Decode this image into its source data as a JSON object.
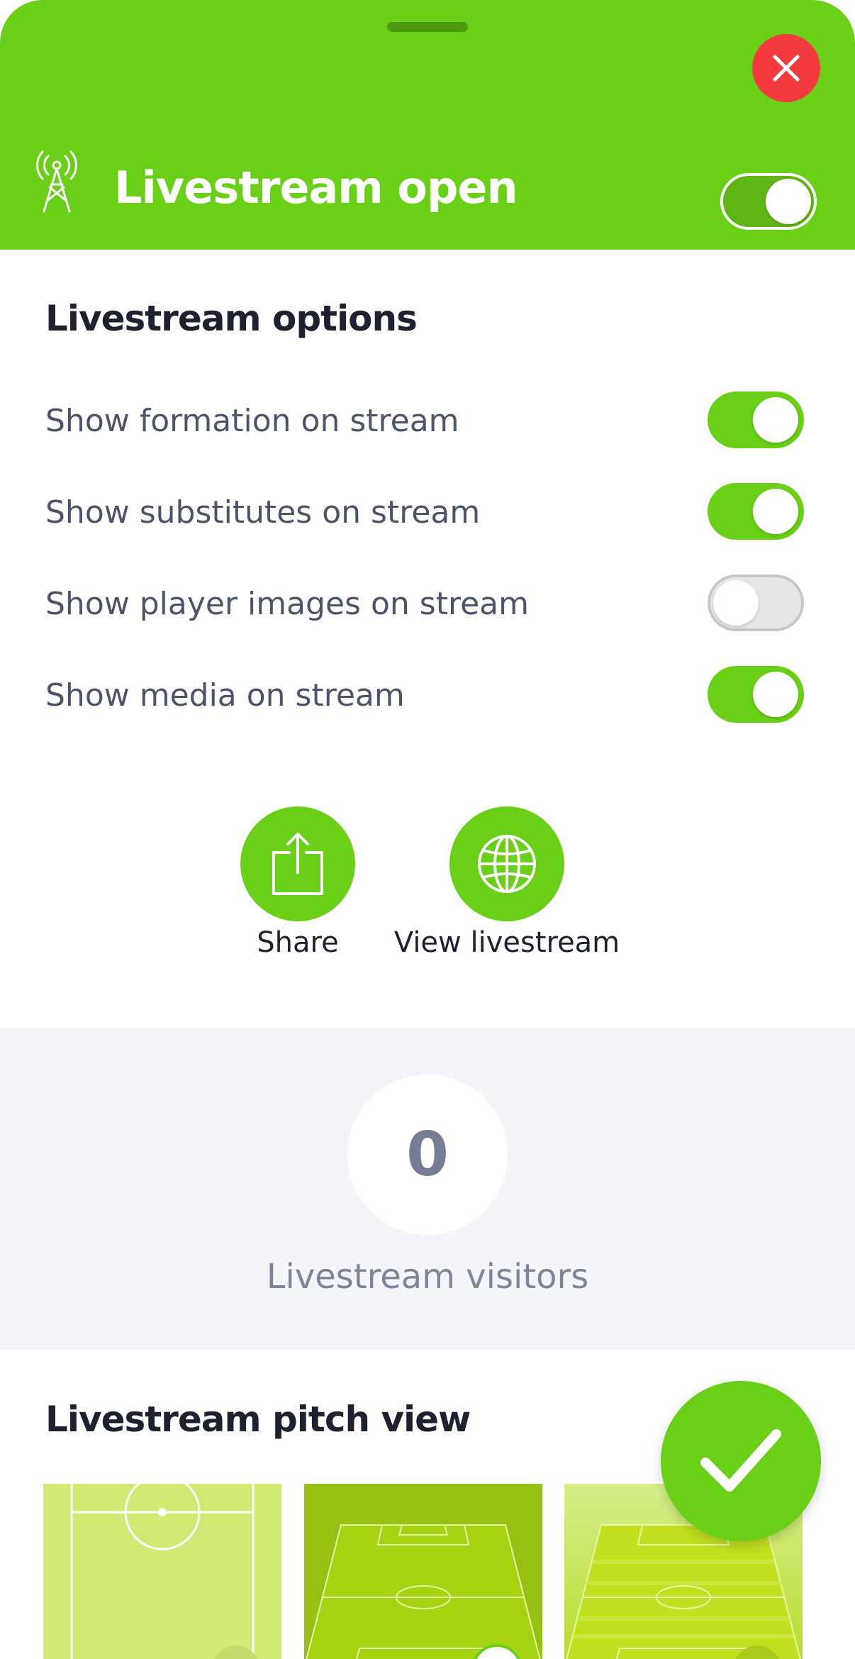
{
  "header": {
    "title": "Livestream open",
    "livestream_enabled": true,
    "icons": {
      "close": "close-icon",
      "antenna": "broadcast-tower-icon"
    }
  },
  "options": {
    "title": "Livestream options",
    "items": [
      {
        "label": "Show formation on stream",
        "enabled": true
      },
      {
        "label": "Show substitutes on stream",
        "enabled": true
      },
      {
        "label": "Show player images on stream",
        "enabled": false
      },
      {
        "label": "Show media on stream",
        "enabled": true
      }
    ]
  },
  "actions": {
    "share_label": "Share",
    "view_label": "View livestream",
    "icons": {
      "share": "share-icon",
      "view": "globe-icon"
    }
  },
  "stats": {
    "visitors_count": "0",
    "visitors_label": "Livestream visitors"
  },
  "pitch_view": {
    "title": "Livestream pitch view",
    "options": [
      "flat-pitch",
      "striped-perspective-pitch",
      "light-perspective-pitch"
    ]
  },
  "colors": {
    "accent": "#6acf17",
    "close": "#f53a3f",
    "title_text": "#1d2130",
    "label_text": "#4b5468",
    "stats_bg": "#f4f5f9"
  },
  "confirm_icon": "checkmark-icon"
}
